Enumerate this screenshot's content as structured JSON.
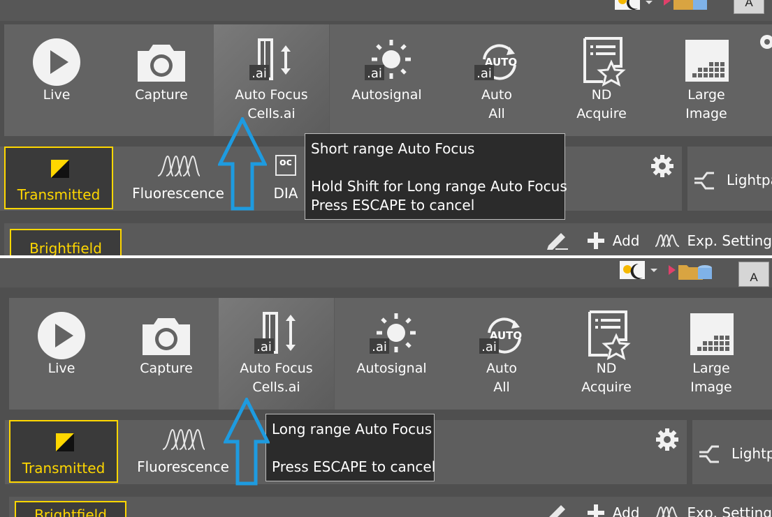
{
  "panels": [
    {
      "toolbar": {
        "tools": [
          {
            "label1": "Live",
            "label2": ""
          },
          {
            "label1": "Capture",
            "label2": ""
          },
          {
            "label1": "Auto Focus",
            "label2": "Cells.ai"
          },
          {
            "label1": "Autosignal",
            "label2": ""
          },
          {
            "label1": "Auto",
            "label2": "All"
          },
          {
            "label1": "ND",
            "label2": "Acquire"
          },
          {
            "label1": "Large",
            "label2": "Image"
          }
        ],
        "ai_badge": ".ai",
        "auto_badge": "AUTO"
      },
      "modes": {
        "transmitted": "Transmitted",
        "fluorescence": "Fluorescence",
        "dia": "DIA",
        "dia_badge": "oc",
        "lightpath": "Lightpa"
      },
      "row": {
        "brightfield": "Brightfield",
        "add": "Add",
        "exp_settings": "Exp. Setting"
      },
      "titlebar": {
        "a_label": "A"
      },
      "tooltip": {
        "line1": "Short range Auto Focus",
        "line2": "",
        "line3": "Hold Shift for Long range Auto Focus",
        "line4": "Press ESCAPE to cancel"
      }
    },
    {
      "toolbar": {
        "tools": [
          {
            "label1": "Live",
            "label2": ""
          },
          {
            "label1": "Capture",
            "label2": ""
          },
          {
            "label1": "Auto Focus",
            "label2": "Cells.ai"
          },
          {
            "label1": "Autosignal",
            "label2": ""
          },
          {
            "label1": "Auto",
            "label2": "All"
          },
          {
            "label1": "ND",
            "label2": "Acquire"
          },
          {
            "label1": "Large",
            "label2": "Image"
          }
        ],
        "ai_badge": ".ai",
        "auto_badge": "AUTO"
      },
      "modes": {
        "transmitted": "Transmitted",
        "fluorescence": "Fluorescence",
        "lightpath": "Lightp"
      },
      "row": {
        "brightfield": "Brightfield",
        "add": "Add",
        "exp_settings": "Exp. Setting"
      },
      "titlebar": {
        "a_label": "A"
      },
      "tooltip": {
        "line1": "Long range Auto Focus",
        "line2": "",
        "line3": "Press ESCAPE to cancel"
      }
    }
  ],
  "colors": {
    "accent_yellow": "#ffd700",
    "arrow_blue": "#1e9be0",
    "tooltip_bg": "#2b2b2b",
    "toolbar_bg": "#636363"
  }
}
